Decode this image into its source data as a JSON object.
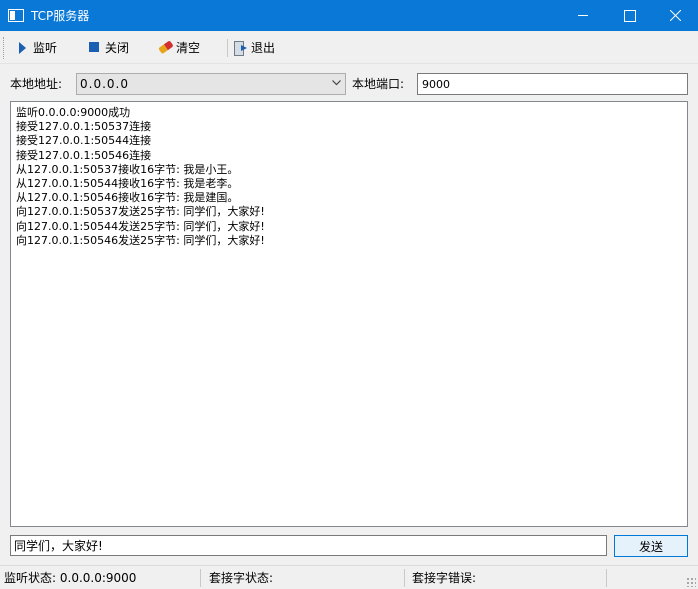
{
  "window": {
    "title": "TCP服务器"
  },
  "toolbar": {
    "listen_label": "监听",
    "close_label": "关闭",
    "clear_label": "清空",
    "exit_label": "退出"
  },
  "config": {
    "address_label": "本地地址:",
    "address_value": "0.0.0.0",
    "port_label": "本地端口:",
    "port_value": "9000"
  },
  "log": {
    "lines": [
      "监听0.0.0.0:9000成功",
      "接受127.0.0.1:50537连接",
      "接受127.0.0.1:50544连接",
      "接受127.0.0.1:50546连接",
      "从127.0.0.1:50537接收16字节: 我是小王。",
      "从127.0.0.1:50544接收16字节: 我是老李。",
      "从127.0.0.1:50546接收16字节: 我是建国。",
      "向127.0.0.1:50537发送25字节: 同学们，大家好!",
      "向127.0.0.1:50544发送25字节: 同学们，大家好!",
      "向127.0.0.1:50546发送25字节: 同学们，大家好!"
    ]
  },
  "message": {
    "value": "同学们，大家好!",
    "send_label": "发送"
  },
  "status": {
    "listen_label": "监听状态:",
    "listen_value": "0.0.0.0:9000",
    "socket_label": "套接字状态:",
    "socket_value": "",
    "error_label": "套接字错误:",
    "error_value": ""
  },
  "colors": {
    "titlebar": "#0a78d7",
    "accent": "#1a5fb4"
  },
  "icons": {
    "app": "window-icon",
    "listen": "play-icon",
    "close": "stop-icon",
    "clear": "eraser-icon",
    "exit": "exit-door-icon"
  }
}
